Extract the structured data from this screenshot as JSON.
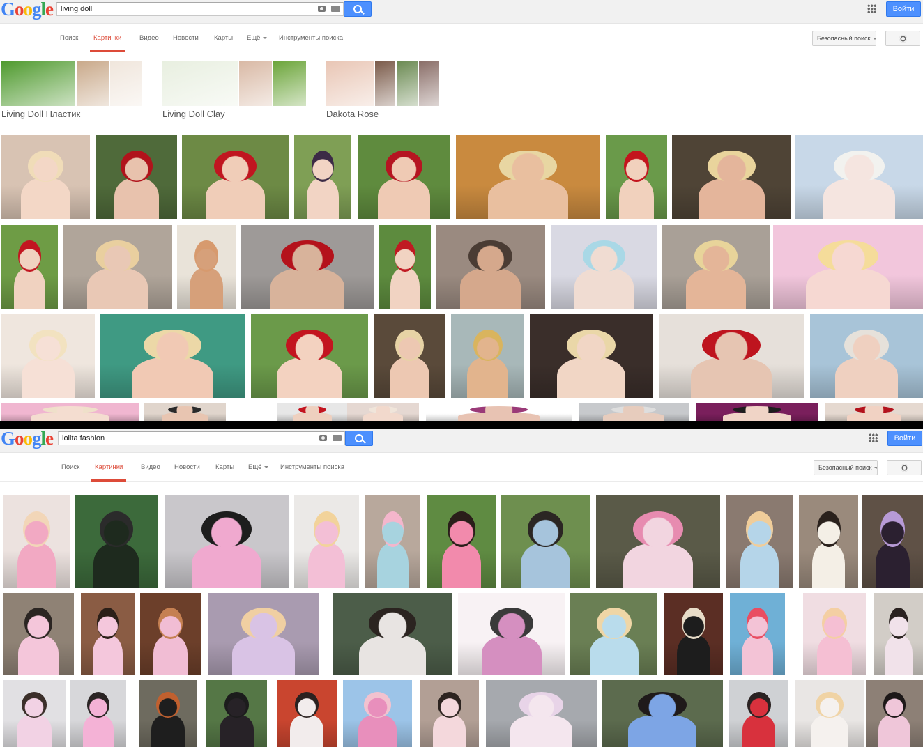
{
  "logo_letters": [
    {
      "ch": "G",
      "color": "#4285f4"
    },
    {
      "ch": "o",
      "color": "#ea4335"
    },
    {
      "ch": "o",
      "color": "#fbbc05"
    },
    {
      "ch": "g",
      "color": "#4285f4"
    },
    {
      "ch": "l",
      "color": "#34a853"
    },
    {
      "ch": "e",
      "color": "#ea4335"
    }
  ],
  "nav_tabs": [
    "Поиск",
    "Картинки",
    "Видео",
    "Новости",
    "Карты",
    "Ещё",
    "Инструменты поиска"
  ],
  "active_tab": "Картинки",
  "signin_label": "Войти",
  "safe_search_label": "Безопасный поиск",
  "accent_color": "#dd4b39",
  "button_color": "#4d90fe",
  "top": {
    "query": "living doll",
    "related": [
      {
        "label": "Living Doll Пластик",
        "colors": [
          "#4f9a2e",
          "#c9a98a",
          "#f0e6dc"
        ]
      },
      {
        "label": "Living Doll Clay",
        "colors": [
          "#e8efe0",
          "#d9b9a5",
          "#6ca53a"
        ]
      },
      {
        "label": "Dakota Rose",
        "colors": [
          "#e9c6b5",
          "#7b5b4a",
          "#6b8a52",
          "#8a6e68"
        ]
      }
    ],
    "rows": [
      [
        {
          "bg": "#d8c3b3",
          "hair": "#f0dcb8",
          "skin": "#f3d7c6"
        },
        {
          "bg": "#4f6a3a",
          "hair": "#b0131b",
          "skin": "#e8c2ad"
        },
        {
          "bg": "#6d8a45",
          "hair": "#c01620",
          "skin": "#f0cdb8"
        },
        {
          "bg": "#7f9f55",
          "hair": "#3c2b46",
          "skin": "#f2d4c4"
        },
        {
          "bg": "#5f8b3e",
          "hair": "#b51521",
          "skin": "#efcab4"
        },
        {
          "bg": "#c98a3f",
          "hair": "#e8d6a2",
          "skin": "#e9bf9f"
        },
        {
          "bg": "#6a9a4a",
          "hair": "#c3141d",
          "skin": "#f1d1bd"
        },
        {
          "bg": "#4f4436",
          "hair": "#e9d49c",
          "skin": "#e4b59b"
        },
        {
          "bg": "#c8d8e8",
          "hair": "#f2f2ef",
          "skin": "#f5e5e0"
        }
      ],
      [
        {
          "bg": "#6e9c45",
          "hair": "#c21620",
          "skin": "#f0d2c0"
        },
        {
          "bg": "#b0a59a",
          "hair": "#e9cf9f",
          "skin": "#e9c8b5"
        },
        {
          "bg": "#e9e3d9",
          "hair": "#d79a6e",
          "skin": "#d6a07a"
        },
        {
          "bg": "#9e9a98",
          "hair": "#b4121b",
          "skin": "#d8b39b"
        },
        {
          "bg": "#5d8b3e",
          "hair": "#c01a22",
          "skin": "#f1d3c2"
        },
        {
          "bg": "#9a8a80",
          "hair": "#4a3c34",
          "skin": "#d5a88c"
        },
        {
          "bg": "#d9d9e3",
          "hair": "#a9d8e6",
          "skin": "#f0dcd2"
        },
        {
          "bg": "#a9a097",
          "hair": "#e8d49a",
          "skin": "#e4b598"
        },
        {
          "bg": "#f2c6dc",
          "hair": "#f5dc9a",
          "skin": "#f6d8d2"
        }
      ],
      [
        {
          "bg": "#efe6de",
          "hair": "#f2e2c0",
          "skin": "#f6e0d6"
        },
        {
          "bg": "#3f9a83",
          "hair": "#ecd8a7",
          "skin": "#f1c9b4"
        },
        {
          "bg": "#6b9a4a",
          "hair": "#c3151f",
          "skin": "#f3d2c0"
        },
        {
          "bg": "#5a4a3a",
          "hair": "#e7d3a5",
          "skin": "#edc8b2"
        },
        {
          "bg": "#a8b8b9",
          "hair": "#d9b45e",
          "skin": "#e2b48d"
        },
        {
          "bg": "#3a2e2a",
          "hair": "#ead7a8",
          "skin": "#f1d6c5"
        },
        {
          "bg": "#e6e0da",
          "hair": "#be141e",
          "skin": "#e6c5b2"
        },
        {
          "bg": "#a8c4d8",
          "hair": "#e6e1da",
          "skin": "#efd0c0"
        }
      ],
      [
        {
          "bg": "#f0b6d0",
          "hair": "#efe0ca",
          "skin": "#f4ddd0"
        },
        {
          "bg": "#e0d5cc",
          "hair": "#2a2a2a",
          "skin": "#e8c5b1"
        },
        {
          "bg": "#e7e7e7",
          "hair": "#c3141f",
          "skin": "#eed0bf"
        },
        {
          "bg": "#e5d8d2",
          "hair": "#f0e5da",
          "skin": "#f2d9cc"
        },
        {
          "bg": "#ffffff",
          "hair": "#9a3a78",
          "skin": "#e8c3b3"
        },
        {
          "bg": "#c7c9cc",
          "hair": "#dedede",
          "skin": "#e7ccbd"
        },
        {
          "bg": "#7a1f5c",
          "hair": "#1e1e1e",
          "skin": "#f0d4c6"
        },
        {
          "bg": "#e5d9d0",
          "hair": "#b3121c",
          "skin": "#f1d2c3"
        }
      ]
    ]
  },
  "bottom": {
    "query": "lolita fashion",
    "rows": [
      [
        {
          "bg": "#ece2df",
          "hair": "#f2d6b8",
          "skin": "#f2a9c3"
        },
        {
          "bg": "#3c6a3b",
          "hair": "#2b2b2b",
          "skin": "#1e2a1e"
        },
        {
          "bg": "#c9c7cb",
          "hair": "#1d1d1d",
          "skin": "#f0a9cf"
        },
        {
          "bg": "#ebe9e7",
          "hair": "#f2d39b",
          "skin": "#f3bfd6"
        },
        {
          "bg": "#b8a89c",
          "hair": "#f4b6cc",
          "skin": "#a7d3df"
        },
        {
          "bg": "#5f8b42",
          "hair": "#2a1e1a",
          "skin": "#f28aac"
        },
        {
          "bg": "#6e8f4f",
          "hair": "#2b2623",
          "skin": "#a6c4dc"
        },
        {
          "bg": "#5a5a48",
          "hair": "#e78bb0",
          "skin": "#f2d5e0"
        },
        {
          "bg": "#8a7a70",
          "hair": "#f0cd9a",
          "skin": "#b5d5e9"
        },
        {
          "bg": "#9a8a7c",
          "hair": "#2a211c",
          "skin": "#f4efe6"
        },
        {
          "bg": "#5f5146",
          "hair": "#b79ad6",
          "skin": "#2b2030"
        }
      ],
      [
        {
          "bg": "#8f8275",
          "hair": "#2b2522",
          "skin": "#f4c6da"
        },
        {
          "bg": "#8a5c44",
          "hair": "#2b1f18",
          "skin": "#f4c7dc"
        },
        {
          "bg": "#6c3f2a",
          "hair": "#c58052",
          "skin": "#f1bdd4"
        },
        {
          "bg": "#a99bb0",
          "hair": "#f0cfa2",
          "skin": "#d9c3e5"
        },
        {
          "bg": "#4c5d49",
          "hair": "#2b2420",
          "skin": "#e8e4e2"
        },
        {
          "bg": "#f8f2f4",
          "hair": "#3a3a3a",
          "skin": "#d58fc0"
        },
        {
          "bg": "#6a7f54",
          "hair": "#efd6a6",
          "skin": "#b9dcec"
        },
        {
          "bg": "#5b2e24",
          "hair": "#e8dcc8",
          "skin": "#1d1d1d"
        },
        {
          "bg": "#6fb0d6",
          "hair": "#e94d62",
          "skin": "#f3c3d6"
        },
        {
          "bg": "#f0dde2",
          "hair": "#f4cfa3",
          "skin": "#f5bfd3"
        },
        {
          "bg": "#d2cdc7",
          "hair": "#2a2220",
          "skin": "#f1e2ea"
        }
      ],
      [
        {
          "bg": "#e1e0e3",
          "hair": "#3b2f2a",
          "skin": "#f2d2e4"
        },
        {
          "bg": "#d7d7da",
          "hair": "#2a2424",
          "skin": "#f4b2d6"
        },
        {
          "bg": "#6e6b5f",
          "hair": "#c0602f",
          "skin": "#1e1e1e"
        },
        {
          "bg": "#557746",
          "hair": "#1c1c1c",
          "skin": "#272227"
        },
        {
          "bg": "#c9452f",
          "hair": "#2a2120",
          "skin": "#f2ecec"
        },
        {
          "bg": "#9cc4e8",
          "hair": "#f2c2cf",
          "skin": "#e88fbc"
        },
        {
          "bg": "#b29f95",
          "hair": "#2d2420",
          "skin": "#f4d8dc"
        },
        {
          "bg": "#a6a9ae",
          "hair": "#e8d4e8",
          "skin": "#f4e6ee"
        },
        {
          "bg": "#5c6b4e",
          "hair": "#1f1a1a",
          "skin": "#7da5e5"
        },
        {
          "bg": "#cfd1d4",
          "hair": "#2a2222",
          "skin": "#d8313d"
        },
        {
          "bg": "#e9e6e4",
          "hair": "#f0d3a4",
          "skin": "#f5f1ee"
        },
        {
          "bg": "#8d8076",
          "hair": "#1d1818",
          "skin": "#efc6d9"
        }
      ]
    ]
  }
}
